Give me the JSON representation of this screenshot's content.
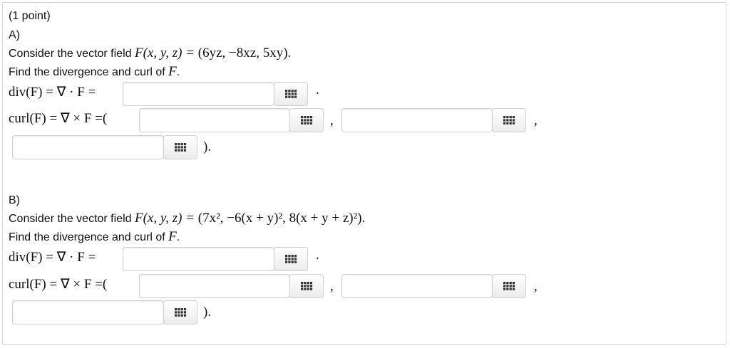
{
  "header": {
    "points": "(1 point)"
  },
  "partA": {
    "label": "A)",
    "intro": "Consider the vector field",
    "field_lhs": "F(x, y, z) = ",
    "field_rhs": "(6yz, −8xz, 5xy).",
    "find_text": "Find the divergence and curl of ",
    "find_F": "F",
    "find_end": ".",
    "div_label": "div(F) = ∇ · F =",
    "div_after": ".",
    "curl_label": "curl(F) = ∇ × F =(",
    "sep1": ",",
    "sep2": ",",
    "close": ").",
    "answers": {
      "div": "",
      "curl_x": "",
      "curl_y": "",
      "curl_z": ""
    }
  },
  "partB": {
    "label": "B)",
    "intro": "Consider the vector field",
    "field_lhs": "F(x, y, z) = ",
    "field_rhs": "(7x², −6(x + y)², 8(x + y + z)²).",
    "find_text": "Find the divergence and curl of ",
    "find_F": "F",
    "find_end": ".",
    "div_label": "div(F) = ∇ · F =",
    "div_after": ".",
    "curl_label": "curl(F) = ∇ × F =(",
    "sep1": ",",
    "sep2": ",",
    "close": ").",
    "answers": {
      "div": "",
      "curl_x": "",
      "curl_y": "",
      "curl_z": ""
    }
  },
  "icons": {
    "equation_editor": "grid-icon"
  },
  "colors": {
    "border": "#cfcfcf",
    "grid": "#333333"
  }
}
